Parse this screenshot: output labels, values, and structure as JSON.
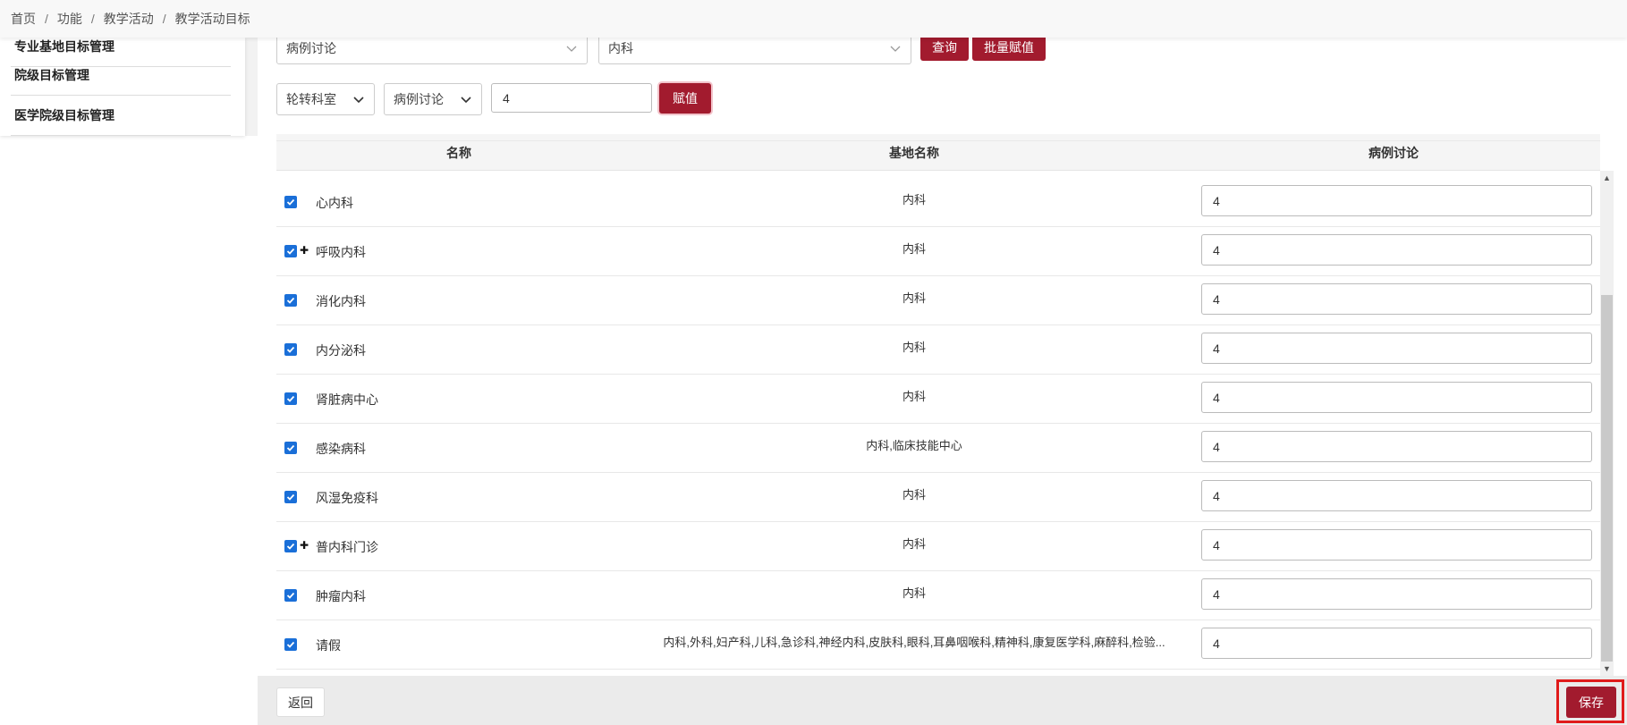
{
  "breadcrumb": [
    "首页",
    "功能",
    "教学活动",
    "教学活动目标"
  ],
  "sidebar": {
    "items": [
      {
        "label": "专业基地目标管理"
      },
      {
        "label": "院级目标管理"
      },
      {
        "label": "医学院级目标管理"
      }
    ]
  },
  "filters": {
    "activity_type": "病例讨论",
    "department": "内科",
    "query_label": "查询",
    "batch_assign_label": "批量赋值"
  },
  "assign_bar": {
    "scope_select": "轮转科室",
    "activity_select": "病例讨论",
    "value": "4",
    "assign_label": "赋值"
  },
  "table": {
    "columns": [
      "名称",
      "基地名称",
      "病例讨论"
    ],
    "rows": [
      {
        "name": "心内科",
        "base": "内科",
        "value": "4",
        "expandable": false
      },
      {
        "name": "呼吸内科",
        "base": "内科",
        "value": "4",
        "expandable": true
      },
      {
        "name": "消化内科",
        "base": "内科",
        "value": "4",
        "expandable": false
      },
      {
        "name": "内分泌科",
        "base": "内科",
        "value": "4",
        "expandable": false
      },
      {
        "name": "肾脏病中心",
        "base": "内科",
        "value": "4",
        "expandable": false
      },
      {
        "name": "感染病科",
        "base": "内科,临床技能中心",
        "value": "4",
        "expandable": false
      },
      {
        "name": "风湿免疫科",
        "base": "内科",
        "value": "4",
        "expandable": false
      },
      {
        "name": "普内科门诊",
        "base": "内科",
        "value": "4",
        "expandable": true
      },
      {
        "name": "肿瘤内科",
        "base": "内科",
        "value": "4",
        "expandable": false
      },
      {
        "name": "请假",
        "base": "内科,外科,妇产科,儿科,急诊科,神经内科,皮肤科,眼科,耳鼻咽喉科,精神科,康复医学科,麻醉科,检验...",
        "value": "4",
        "expandable": false
      }
    ]
  },
  "footer": {
    "back_label": "返回",
    "save_label": "保存"
  },
  "colors": {
    "accent": "#a21b2e",
    "checkbox": "#1a6fd8",
    "highlight": "#e01b1b"
  }
}
